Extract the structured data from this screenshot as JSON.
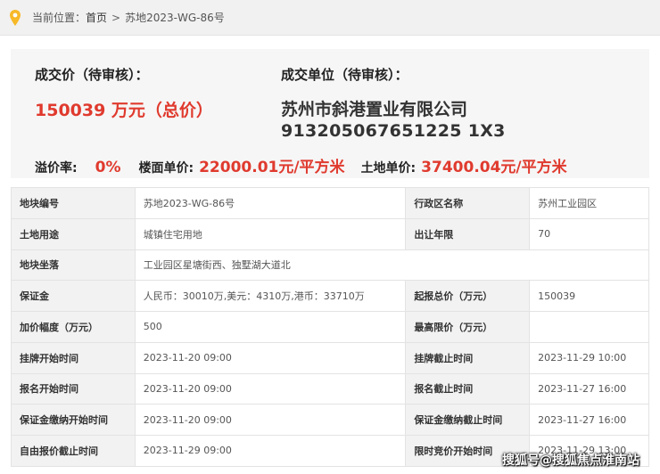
{
  "breadcrumb": {
    "prefix": "当前位置：",
    "home": "首页",
    "separator": ">",
    "current": "苏地2023-WG-86号"
  },
  "summary": {
    "price_label": "成交价（待审核）：",
    "price_value": "150039 万元（总价）",
    "winner_label": "成交单位（待审核）：",
    "winner_name": "苏州市斜港置业有限公司",
    "winner_code": "913205067651225 1X3",
    "premium_label": "溢价率:",
    "premium_value": "0%",
    "floor_price_label": "楼面单价:",
    "floor_price_value": "22000.01元/平方米",
    "land_price_label": "土地单价:",
    "land_price_value": "37400.04元/平方米"
  },
  "colors": {
    "accent_red": "#e03a2e",
    "pin_yellow": "#f7b928"
  },
  "table": [
    {
      "l1": "地块编号",
      "v1": "苏地2023-WG-86号",
      "l2": "行政区名称",
      "v2": "苏州工业园区"
    },
    {
      "l1": "土地用途",
      "v1": "城镇住宅用地",
      "l2": "出让年限",
      "v2": "70"
    },
    {
      "l1": "地块坐落",
      "v1": "工业园区星塘街西、独墅湖大道北",
      "l2": "",
      "v2": ""
    },
    {
      "l1": "保证金",
      "v1": "人民币：30010万,美元：4310万,港币：33710万",
      "l2": "起报总价（万元）",
      "v2": "150039"
    },
    {
      "l1": "加价幅度（万元）",
      "v1": "500",
      "l2": "最高限价（万元）",
      "v2": ""
    },
    {
      "l1": "挂牌开始时间",
      "v1": "2023-11-20 09:00",
      "l2": "挂牌截止时间",
      "v2": "2023-11-29 10:00"
    },
    {
      "l1": "报名开始时间",
      "v1": "2023-11-20 09:00",
      "l2": "报名截止时间",
      "v2": "2023-11-27 16:00"
    },
    {
      "l1": "保证金缴纳开始时间",
      "v1": "2023-11-20 09:00",
      "l2": "保证金缴纳截止时间",
      "v2": "2023-11-27 16:00"
    },
    {
      "l1": "自由报价截止时间",
      "v1": "2023-11-29 09:00",
      "l2": "限时竞价开始时间",
      "v2": "2023-11-29 13:00"
    }
  ],
  "watermark": "搜狐号@搜狐焦点淮南站"
}
